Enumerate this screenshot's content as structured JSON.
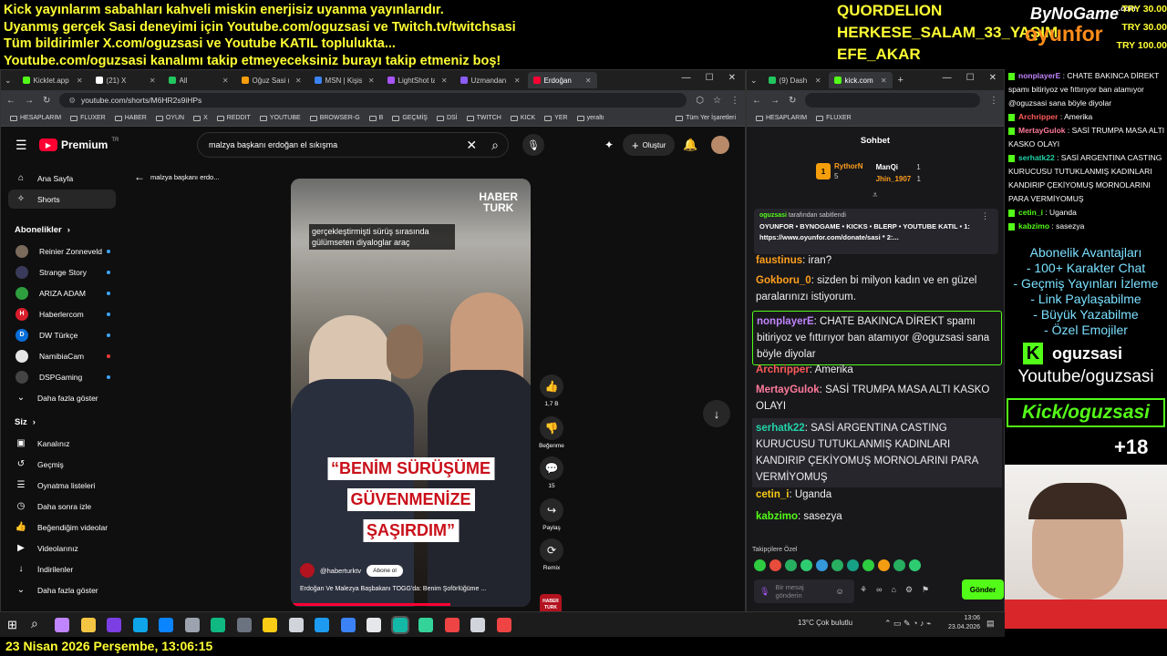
{
  "banner": {
    "lines": [
      "Kick yayınlarım sabahları kahveli miskin enerjisiz uyanma yayınlarıdır.",
      "Uyanmış gerçek Sasi deneyimi için Youtube.com/oguzsasi ve Twitch.tv/twitchsasi",
      "Tüm bildirimler X.com/oguzsasi ve Youtube KATIL toplulukta...",
      "Youtube.com/oguzsasi kanalımı takip etmeyeceksiniz burayı takip etmeniz boş!"
    ],
    "donors": [
      "QUORDELION",
      "HERKESE_SALAM_33_YAŞIM",
      "EFE_AKAR"
    ],
    "logo_top": "ByNoGame",
    "logo_com": ".com",
    "logo_bottom": "oyunfor",
    "donations": [
      "TRY 30.00",
      "TRY 30.00",
      "TRY 100.00"
    ]
  },
  "browser_left": {
    "tabs": [
      {
        "label": "Kicklet.app -",
        "color": "#53fc18",
        "active": false
      },
      {
        "label": "(21) X",
        "color": "#ffffff",
        "active": false
      },
      {
        "label": "All",
        "color": "#22c55e",
        "active": false
      },
      {
        "label": "Oğuz Sasi (u",
        "color": "#f59e0b",
        "active": false
      },
      {
        "label": "MSN | Kişisel",
        "color": "#3b82f6",
        "active": false
      },
      {
        "label": "LightShot ta",
        "color": "#a855f7",
        "active": false
      },
      {
        "label": "Uzmandan s",
        "color": "#8b5cf6",
        "active": false
      },
      {
        "label": "Erdoğan",
        "color": "#ff0033",
        "active": true
      }
    ],
    "url": "youtube.com/shorts/M6HR2s9iHPs",
    "bookmarks": [
      "HESAPLARIM",
      "FLUXER",
      "HABER",
      "OYUN",
      "X",
      "REDDIT",
      "YOUTUBE",
      "BROWSER-G",
      "B",
      "GEÇMİŞ",
      "DSİ",
      "TWITCH",
      "KICK",
      "YER",
      "yeraltı"
    ],
    "bookmarks_all": "Tüm Yer İşaretleri"
  },
  "youtube": {
    "brand": "Premium",
    "brand_sup": "TR",
    "search_value": "malzya başkanı erdoğan el sıkışma",
    "create_label": "Oluştur",
    "back_label": "malzya başkanı erdo...",
    "nav": [
      {
        "label": "Ana Sayfa"
      },
      {
        "label": "Shorts"
      }
    ],
    "subs_title": "Abonelikler",
    "subs": [
      {
        "label": "Reinier Zonneveld",
        "color": "#7a6a5a",
        "initial": ""
      },
      {
        "label": "Strange Story",
        "color": "#3a3a5a",
        "initial": ""
      },
      {
        "label": "ARIZA ADAM",
        "color": "#2e9e3e",
        "initial": ""
      },
      {
        "label": "Haberlercom",
        "color": "#d81e2c",
        "initial": "H"
      },
      {
        "label": "DW Türkçe",
        "color": "#0a6fd8",
        "initial": "D"
      },
      {
        "label": "NamibiaCam",
        "color": "#e6e6e6",
        "initial": ""
      },
      {
        "label": "DSPGaming",
        "color": "#444",
        "initial": ""
      }
    ],
    "more_label": "Daha fazla göster",
    "you_title": "Siz",
    "you_items": [
      {
        "label": "Kanalınız"
      },
      {
        "label": "Geçmiş"
      },
      {
        "label": "Oynatma listeleri"
      },
      {
        "label": "Daha sonra izle"
      },
      {
        "label": "Beğendiğim videolar"
      },
      {
        "label": "Videolarınız"
      },
      {
        "label": "İndirilenler"
      },
      {
        "label": "Daha fazla göster"
      }
    ],
    "video": {
      "caption": "gerçekleştirmişti sürüş sırasında gülümseten diyaloglar araç",
      "logo_line1": "HABER",
      "logo_line2": "TURK",
      "quote": [
        "“BENİM SÜRÜŞÜME",
        "GÜVENMENİZE",
        "ŞAŞIRDIM”"
      ],
      "channel": "@haberturktv",
      "subscribe": "Abone ol",
      "title": "Erdoğan Ve Malezya Başbakanı TOGG'da: Benim Şoförlüğüme ...",
      "badge_line1": "HABER",
      "badge_line2": "TURK"
    },
    "actions": [
      {
        "icon": "👍",
        "label": "1,7 B"
      },
      {
        "icon": "👎",
        "label": "Beğenme"
      },
      {
        "icon": "💬",
        "label": "15"
      },
      {
        "icon": "↪",
        "label": "Paylaş"
      },
      {
        "icon": "⟳",
        "label": "Remix"
      }
    ]
  },
  "browser_right": {
    "tabs": [
      {
        "label": "(9) Dash",
        "color": "#22c55e"
      },
      {
        "label": "kick.com",
        "color": "#53fc18"
      }
    ],
    "bookmarks": [
      "HESAPLARIM",
      "FLUXER"
    ],
    "chat_title": "Sohbet",
    "top_gifters": [
      {
        "name": "RythorN",
        "count": "5"
      },
      {
        "name": "ManQi",
        "count": "1"
      },
      {
        "name": "Jhin_1907",
        "count": "1"
      }
    ],
    "pinned_by": "oguzsasi",
    "pinned_suffix": "tarafından sabitlendi",
    "pinned_text": "OYUNFOR • BYNOGAME • KICKS • BLERP • YOUTUBE KATIL • 1: https://www.oyunfor.com/donate/sasi * 2:...",
    "messages": [
      {
        "user": "faustinus",
        "color": "#ff9f1c",
        "text": "iran?"
      },
      {
        "user": "Gokboru_0",
        "color": "#ff9f1c",
        "text": "sizden bi milyon kadın ve en güzel paralarınızı istiyorum."
      },
      {
        "user": "nonplayerE",
        "color": "#c084fc",
        "text": "CHATE BAKINCA DİREKT spamı bitiriyoz ve fıttırıyor ban atamıyor @oguzsasi sana böyle diyolar"
      },
      {
        "user": "Archripper",
        "color": "#ff5a5a",
        "text": "Amerika"
      },
      {
        "user": "MertayGulok",
        "color": "#ff7a9a",
        "text": "SASİ TRUMPA MASA ALTI KASKO OLAYI"
      },
      {
        "user": "serhatk22",
        "color": "#22d3a8",
        "text": "SASİ ARGENTINA CASTING KURUCUSU TUTUKLANMIŞ KADINLARI KANDIRIP ÇEKİYOMUŞ MORNOLARINI PARA VERMİYOMUŞ"
      },
      {
        "user": "cetin_i",
        "color": "#facc15",
        "text": "Uganda"
      },
      {
        "user": "kabzimo",
        "color": "#53fc18",
        "text": "sasezya"
      }
    ],
    "emote_label": "Takipçilere Özel",
    "input_placeholder": "Bir mesaj gönderin",
    "send_label": "Gönder"
  },
  "overlay_chat": [
    {
      "user": "nonplayerE",
      "color": "#c084fc",
      "text": "CHATE BAKINCA DİREKT spamı bitiriyoz ve fıttırıyor ban atamıyor @oguzsasi sana böyle diyolar"
    },
    {
      "user": "Archripper",
      "color": "#ff5a5a",
      "text": "Amerika"
    },
    {
      "user": "MertayGulok",
      "color": "#ff7a9a",
      "text": "SASİ TRUMPA MASA ALTI KASKO OLAYI"
    },
    {
      "user": "serhatk22",
      "color": "#22d3a8",
      "text": "SASİ ARGENTINA CASTING KURUCUSU TUTUKLANMIŞ KADINLARI KANDIRIP ÇEKİYOMUŞ MORNOLARINI PARA VERMİYOMUŞ"
    },
    {
      "user": "cetin_i",
      "color": "#53fc18",
      "text": "Uganda"
    },
    {
      "user": "kabzimo",
      "color": "#53fc18",
      "text": "sasezya"
    }
  ],
  "overlay_perks": {
    "title": "Abonelik Avantajları",
    "items": [
      "- 100+ Karakter Chat",
      "- Geçmiş Yayınları İzleme",
      "- Link Paylaşabilme",
      "- Büyük Yazabilme",
      "- Özel Emojiler"
    ],
    "kick_name": "oguzsasi",
    "youtube": "Youtube/oguzsasi",
    "kick_banner": "Kick/oguzsasi",
    "age": "+18"
  },
  "taskbar": {
    "weather": "13°C  Çok bulutlu",
    "time": "13:06",
    "date": "23.04.2026"
  },
  "clock_bar": "23 Nisan 2026 Perşembe, 13:06:15",
  "colors": {
    "yt_red": "#ff0033",
    "kick_green": "#53fc18",
    "banner_yellow": "#ffff33",
    "quote_red": "#c9101a"
  }
}
